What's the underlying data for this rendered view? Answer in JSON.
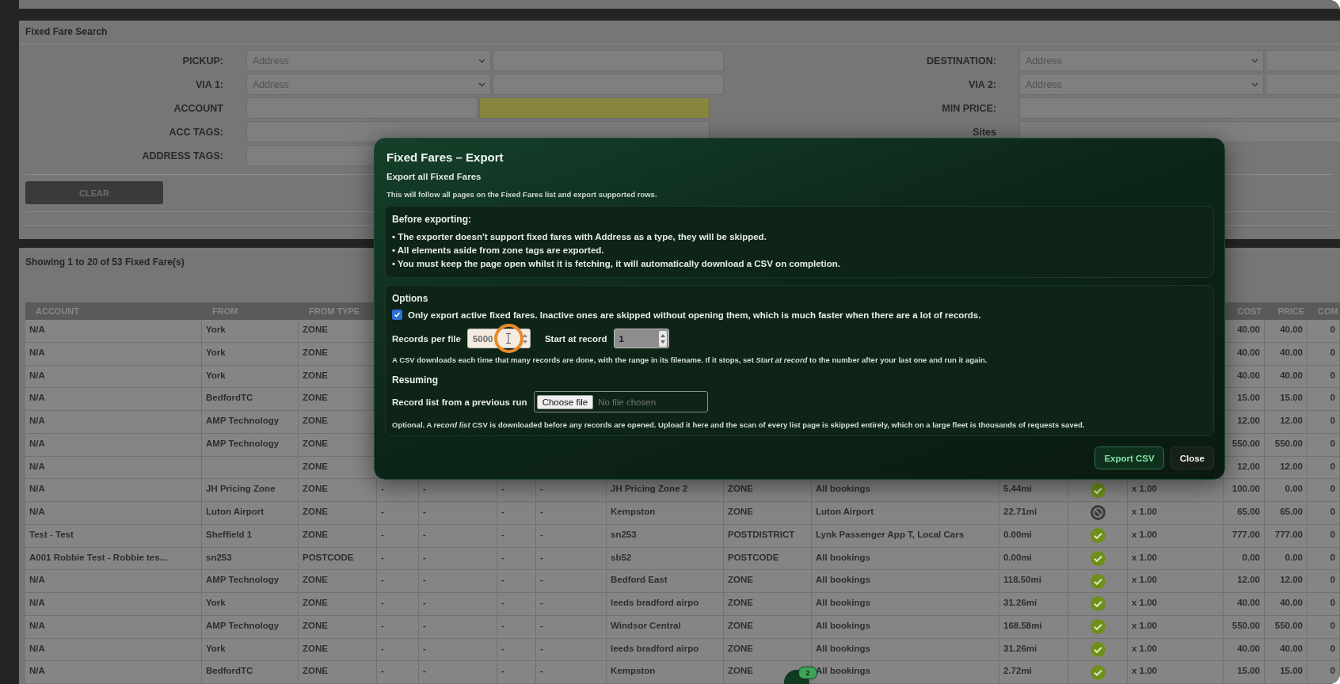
{
  "search_panel": {
    "title": "Fixed Fare Search",
    "left_fields": [
      {
        "label": "PICKUP:",
        "kind": "select_pair",
        "value": "Address"
      },
      {
        "label": "VIA 1:",
        "kind": "select_pair",
        "value": "Address"
      },
      {
        "label": "ACCOUNT",
        "kind": "input_pair",
        "highlighted": true
      },
      {
        "label": "ACC TAGS:",
        "kind": "input"
      },
      {
        "label": "ADDRESS TAGS:",
        "kind": "input"
      }
    ],
    "right_fields": [
      {
        "label": "DESTINATION:",
        "kind": "select_pair",
        "value": "Address"
      },
      {
        "label": "VIA 2:",
        "kind": "select_pair",
        "value": "Address"
      },
      {
        "label": "MIN PRICE:",
        "kind": "input"
      },
      {
        "label": "Sites",
        "kind": "input"
      }
    ],
    "clear_button": "CLEAR"
  },
  "results": {
    "summary": "Showing 1 to 20 of 53 Fixed Fare(s)",
    "columns": [
      {
        "label": "ACCOUNT",
        "kind": "text"
      },
      {
        "label": "FROM",
        "kind": "text"
      },
      {
        "label": "FROM TYPE",
        "kind": "text"
      },
      {
        "kind": "text"
      },
      {
        "kind": "text"
      },
      {
        "kind": "text"
      },
      {
        "kind": "text"
      },
      {
        "kind": "text"
      },
      {
        "kind": "text"
      },
      {
        "kind": "text"
      },
      {
        "kind": "text"
      },
      {
        "kind": "status"
      },
      {
        "kind": "text"
      },
      {
        "label": "COST",
        "kind": "number"
      },
      {
        "label": "PRICE",
        "kind": "number"
      },
      {
        "label": "COM",
        "kind": "number"
      }
    ],
    "rows": [
      {
        "cells": [
          "N/A",
          "York",
          "ZONE",
          null,
          null,
          null,
          null,
          null,
          null,
          null,
          null,
          null,
          null,
          "40.00",
          "40.00",
          "0"
        ]
      },
      {
        "cells": [
          "N/A",
          "York",
          "ZONE",
          null,
          null,
          null,
          null,
          null,
          null,
          null,
          null,
          null,
          null,
          "40.00",
          "40.00",
          "0"
        ]
      },
      {
        "cells": [
          "N/A",
          "York",
          "ZONE",
          null,
          null,
          null,
          null,
          null,
          null,
          null,
          null,
          null,
          null,
          "40.00",
          "40.00",
          "0"
        ]
      },
      {
        "cells": [
          "N/A",
          "BedfordTC",
          "ZONE",
          null,
          null,
          null,
          null,
          null,
          null,
          null,
          null,
          null,
          null,
          "15.00",
          "15.00",
          "0"
        ]
      },
      {
        "cells": [
          "N/A",
          "AMP Technology",
          "ZONE",
          null,
          null,
          null,
          null,
          null,
          null,
          null,
          null,
          null,
          null,
          "12.00",
          "12.00",
          "0"
        ]
      },
      {
        "cells": [
          "N/A",
          "AMP Technology",
          "ZONE",
          null,
          null,
          null,
          null,
          null,
          null,
          null,
          null,
          null,
          null,
          "550.00",
          "550.00",
          "0"
        ]
      },
      {
        "cells": [
          "N/A",
          null,
          "ZONE",
          null,
          null,
          null,
          null,
          null,
          null,
          null,
          null,
          null,
          null,
          "12.00",
          "12.00",
          "0"
        ]
      },
      {
        "active": true,
        "cells": [
          "N/A",
          "JH Pricing Zone",
          "ZONE",
          "-",
          "-",
          "-",
          "-",
          "JH Pricing Zone 2",
          "ZONE",
          "All bookings",
          "5.44mi",
          null,
          "x 1.00",
          "100.00",
          "0.00",
          "0"
        ]
      },
      {
        "active": false,
        "cells": [
          "N/A",
          "Luton Airport",
          "ZONE",
          "-",
          "-",
          "-",
          "-",
          "Kempston",
          "ZONE",
          "Luton Airport",
          "22.71mi",
          null,
          "x 1.00",
          "65.00",
          "65.00",
          "0"
        ]
      },
      {
        "active": true,
        "cells": [
          "Test - Test",
          "Sheffield 1",
          "ZONE",
          "-",
          "-",
          "-",
          "-",
          "sn253",
          "POSTDISTRICT",
          "Lynk Passenger App T, Local Cars",
          "0.00mi",
          null,
          "x 1.00",
          "777.00",
          "777.00",
          "0"
        ]
      },
      {
        "active": true,
        "cells": [
          "A001 Robbie Test - Robbie tes...",
          "sn253",
          "POSTCODE",
          "-",
          "-",
          "-",
          "-",
          "sb52",
          "POSTCODE",
          "All bookings",
          "0.00mi",
          null,
          "x 1.00",
          "0.00",
          "0.00",
          "0"
        ]
      },
      {
        "active": true,
        "cells": [
          "N/A",
          "AMP Technology",
          "ZONE",
          "-",
          "-",
          "-",
          "-",
          "Bedford East",
          "ZONE",
          "All bookings",
          "118.50mi",
          null,
          "x 1.00",
          "12.00",
          "12.00",
          "0"
        ]
      },
      {
        "active": true,
        "cells": [
          "N/A",
          "York",
          "ZONE",
          "-",
          "-",
          "-",
          "-",
          "leeds bradford airpo",
          "ZONE",
          "All bookings",
          "31.26mi",
          null,
          "x 1.00",
          "40.00",
          "40.00",
          "0"
        ]
      },
      {
        "active": true,
        "cells": [
          "N/A",
          "AMP Technology",
          "ZONE",
          "-",
          "-",
          "-",
          "-",
          "Windsor Central",
          "ZONE",
          "All bookings",
          "168.58mi",
          null,
          "x 1.00",
          "550.00",
          "550.00",
          "0"
        ]
      },
      {
        "active": true,
        "cells": [
          "N/A",
          "York",
          "ZONE",
          "-",
          "-",
          "-",
          "-",
          "leeds bradford airpo",
          "ZONE",
          "All bookings",
          "31.26mi",
          null,
          "x 1.00",
          "40.00",
          "40.00",
          "0"
        ]
      },
      {
        "active": true,
        "cells": [
          "N/A",
          "BedfordTC",
          "ZONE",
          "-",
          "-",
          "-",
          "-",
          "Kempston",
          "ZONE",
          "All bookings",
          "2.72mi",
          null,
          "x 1.00",
          "15.00",
          "15.00",
          "0"
        ]
      }
    ]
  },
  "export_dialog": {
    "title": "Fixed Fares – Export",
    "subtitle": "Export all Fixed Fares",
    "description": "This will follow all pages on the Fixed Fares list and export supported rows.",
    "before": {
      "heading": "Before exporting:",
      "bullets": [
        "• The exporter doesn't support fixed fares with Address as a type, they will be skipped.",
        "• All elements aside from zone tags are exported.",
        "• You must keep the page open whilst it is fetching, it will automatically download a CSV on completion."
      ]
    },
    "options": {
      "heading": "Options",
      "active_only": {
        "checked": true,
        "label": "**Only export active fixed fares.** Inactive ones are skipped without opening them, which is much faster when there are a lot of records."
      },
      "records_per_file": {
        "label": "Records per file",
        "value": "5000"
      },
      "start_at_record": {
        "label": "Start at record",
        "value": "1"
      },
      "hint": "A CSV downloads each time that many records are done, with the range in its filename. If it stops, set *Start at record* to the number after your last one and run it again."
    },
    "resuming": {
      "heading": "Resuming",
      "file": {
        "label": "Record list from a previous run",
        "button": "Choose file",
        "status": "No file chosen"
      },
      "note": "Optional. A *record list* CSV is downloaded before any records are opened. Upload it here and the scan of every list page is skipped entirely, which on a large fleet is thousands of requests saved."
    },
    "buttons": [
      {
        "label": "Export CSV",
        "kind": "primary"
      },
      {
        "label": "Close",
        "kind": "secondary"
      }
    ]
  },
  "chat_button": {
    "badge": "2"
  }
}
